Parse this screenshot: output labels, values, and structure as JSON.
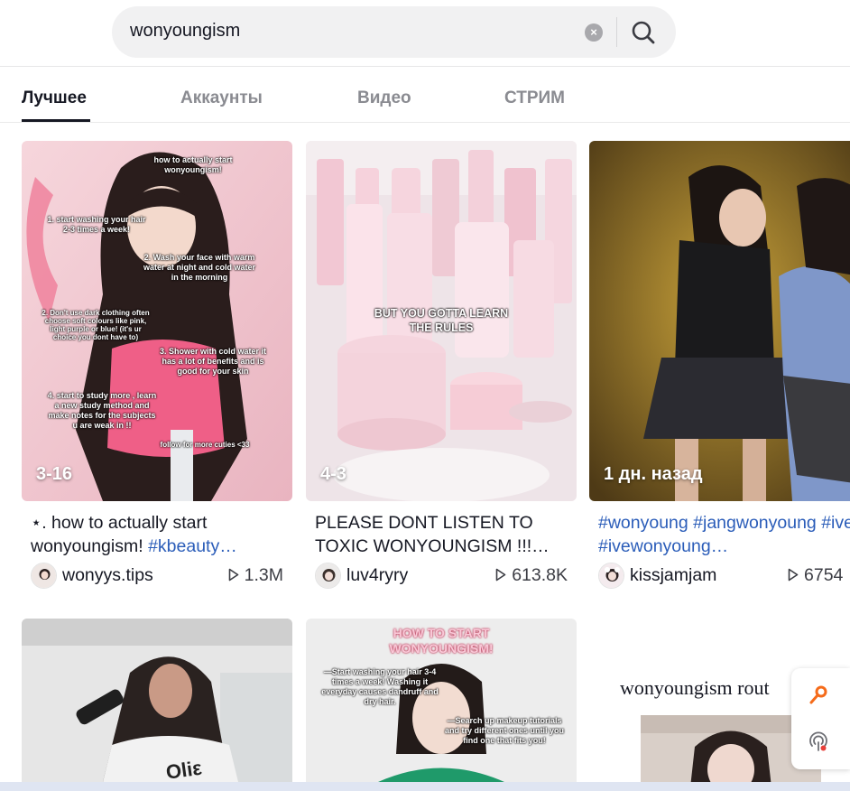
{
  "search": {
    "query": "wonyoungism"
  },
  "tabs": [
    {
      "label": "Лучшее"
    },
    {
      "label": "Аккаунты"
    },
    {
      "label": "Видео"
    },
    {
      "label": "СТРИМ"
    }
  ],
  "videos": [
    {
      "timestamp": "3-16",
      "caption_text": "⋆. how to actually start wonyoungism! ",
      "caption_tags": "#kbeauty…",
      "username": "wonyys.tips",
      "views": "1.3M",
      "overlay": {
        "title": "how to actually start wonyoungism!",
        "tips": [
          "1. start washing your hair 2-3 times a week!",
          "2. Wash your face with warm water at night and cold water in the morning",
          "2. Don't use dark clothing often choose soft colours like pink, light purple or blue! (it's ur choice you dont have to)",
          "3. Shower with cold water it has a lot of benefits and is good for your skin",
          "4. start to study more , learn a new study method and make notes for the subjects u are weak in !!"
        ],
        "footer": "follow for more cuties <33"
      }
    },
    {
      "timestamp": "4-3",
      "caption_text": "PLEASE DONT LISTEN TO TOXIC WONYOUNGISM !!!…",
      "caption_tags": "",
      "username": "luv4ryry",
      "views": "613.8K",
      "overlay": {
        "line1": "BUT YOU GOTTA LEARN",
        "line2": "THE RULES"
      }
    },
    {
      "timestamp": "1 дн. назад",
      "caption_text": "",
      "caption_tags": "#wonyoung #jangwonyoung #ive #ivewonyoung…",
      "username": "kissjamjam",
      "views": "6754"
    }
  ],
  "row2": {
    "card2_title": "HOW TO START WONYOUNGISM!",
    "card2_tip1": "—Start washing your hair 3-4 times a week! Washing it everyday causes dandruff and dry hair.",
    "card2_tip2": "—Search up makeup tutorials and try different ones until you find one that fits you!",
    "card3_title": "wonyoungism rout"
  },
  "colors": {
    "tag_blue": "#2b5db9",
    "accent_orange": "#f56b1a"
  }
}
